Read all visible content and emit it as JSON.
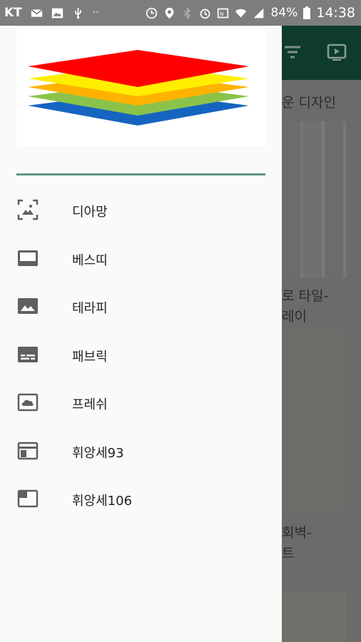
{
  "status_bar": {
    "carrier": "KT",
    "battery": "84%",
    "time": "14:38"
  },
  "background_app": {
    "partial_title": "운 디자인",
    "item_1": [
      "로 타일-",
      "레이"
    ],
    "item_2": [
      "회벽-",
      "트"
    ]
  },
  "drawer": {
    "logo_name": "layered-logo",
    "menu": [
      {
        "label": "디아망",
        "icon": "photo-frame-icon"
      },
      {
        "label": "베스띠",
        "icon": "tablet-bottom-bar-icon"
      },
      {
        "label": "테라피",
        "icon": "landscape-image-icon"
      },
      {
        "label": "패브릭",
        "icon": "subtitles-icon"
      },
      {
        "label": "프레쉬",
        "icon": "cloud-frame-icon"
      },
      {
        "label": "휘앙세93",
        "icon": "web-window-icon"
      },
      {
        "label": "휘앙세106",
        "icon": "picture-in-picture-icon"
      }
    ]
  },
  "colors": {
    "appbar": "#0e3b2e",
    "divider": "#5e9688",
    "icon": "#5f5f5f"
  }
}
